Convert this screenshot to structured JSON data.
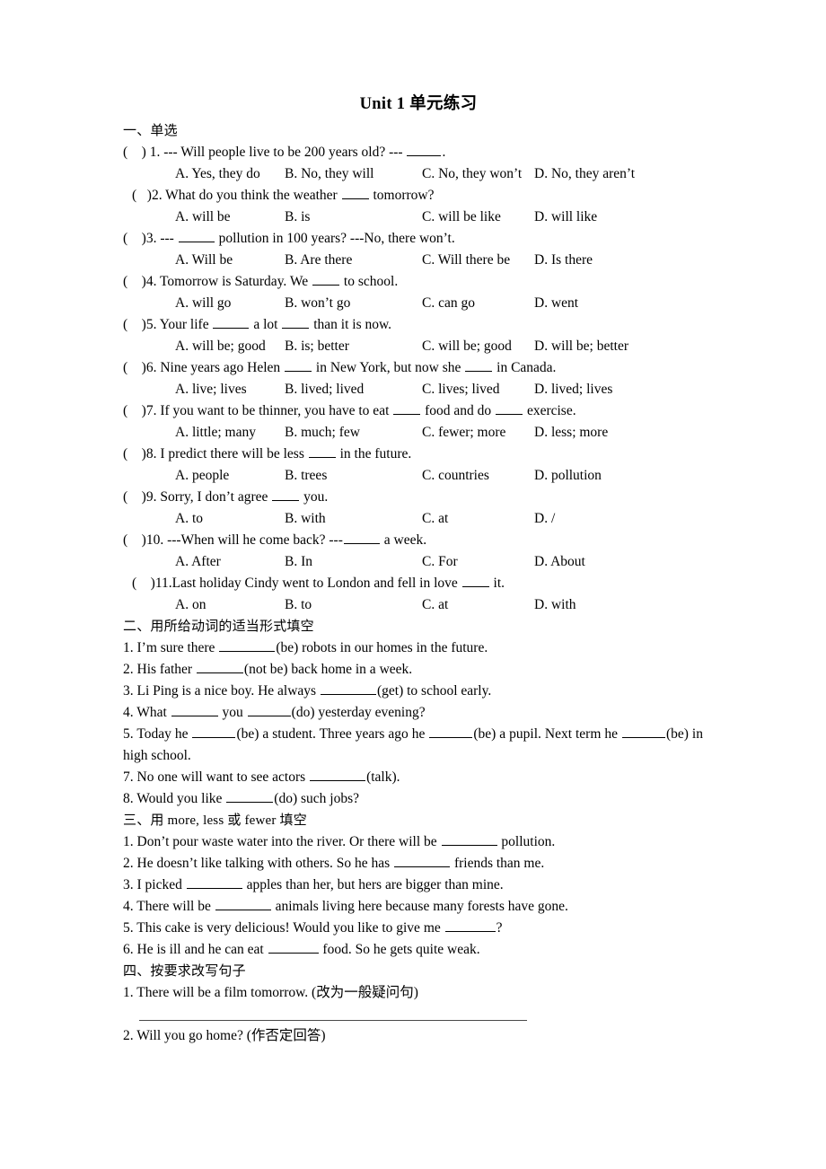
{
  "document": {
    "title": "Unit 1  单元练习"
  },
  "sections": [
    {
      "id": "section-one",
      "heading": "一、单选",
      "questions": [
        {
          "num": "1",
          "indent": false,
          "stem_pre": "(    ) 1. --- Will people live to be 200 years old? --- ",
          "blank_width": 38,
          "stem_post": ".",
          "options": [
            "A. Yes, they do",
            "B. No, they will",
            "C. No, they won’t",
            "D. No, they aren’t"
          ]
        },
        {
          "num": "2",
          "indent": true,
          "stem_pre": "(   )2. What do you think the weather ",
          "blank_width": 30,
          "stem_post": " tomorrow?",
          "options": [
            "A. will be",
            "B. is",
            "C. will be like",
            "D. will like"
          ]
        },
        {
          "num": "3",
          "indent": false,
          "stem_pre": "(    )3. --- ",
          "blank_width": 40,
          "stem_post": " pollution in 100 years? ---No, there won’t.",
          "options": [
            "A. Will be",
            "B. Are there",
            "C. Will there be",
            "D. Is there"
          ]
        },
        {
          "num": "4",
          "indent": false,
          "stem_pre": "(    )4. Tomorrow is Saturday. We ",
          "blank_width": 30,
          "stem_post": " to school.",
          "options": [
            "A. will go",
            "B. won’t go",
            "C. can go",
            "D. went"
          ]
        },
        {
          "num": "5",
          "indent": false,
          "stem_pre": "(    )5. Your life ",
          "blank_width": 40,
          "stem_mid": " a lot ",
          "blank2_width": 30,
          "stem_post": " than it is now.",
          "options": [
            "A. will be; good",
            "B. is; better",
            "C. will be; good",
            "D. will be; better"
          ]
        },
        {
          "num": "6",
          "indent": false,
          "stem_pre": "(    )6. Nine years ago Helen ",
          "blank_width": 30,
          "stem_mid": " in New York, but now she ",
          "blank2_width": 30,
          "stem_post": " in Canada.",
          "options": [
            "A. live; lives",
            "B. lived; lived",
            "C. lives; lived",
            "D. lived; lives"
          ]
        },
        {
          "num": "7",
          "indent": false,
          "stem_pre": "(    )7. If you want to be thinner, you have to eat ",
          "blank_width": 30,
          "stem_mid": " food and do ",
          "blank2_width": 30,
          "stem_post": " exercise.",
          "options": [
            "A. little; many",
            "B. much; few",
            "C. fewer; more",
            "D. less; more"
          ]
        },
        {
          "num": "8",
          "indent": false,
          "stem_pre": "(    )8. I predict there will be less ",
          "blank_width": 30,
          "stem_post": " in the future.",
          "options": [
            "A. people",
            "B. trees",
            "C. countries",
            "D. pollution"
          ]
        },
        {
          "num": "9",
          "indent": false,
          "stem_pre": "(    )9. Sorry, I don’t agree ",
          "blank_width": 30,
          "stem_post": " you.",
          "options": [
            "A. to",
            "B. with",
            "C. at",
            "D. /"
          ]
        },
        {
          "num": "10",
          "indent": false,
          "stem_pre": "(    )10. ---When will he come back? ---",
          "blank_width": 40,
          "stem_post": " a week.",
          "options": [
            "A. After",
            "B. In",
            "C. For",
            "D. About"
          ]
        },
        {
          "num": "11",
          "indent": true,
          "stem_pre": "(    )11.Last holiday Cindy went to London and fell in love ",
          "blank_width": 30,
          "stem_post": " it.",
          "options": [
            "A. on",
            "B. to",
            "C. at",
            "D. with"
          ]
        }
      ]
    },
    {
      "id": "section-two",
      "heading": "二、用所给动词的适当形式填空",
      "items": [
        {
          "pre": "1. I’m sure there ",
          "blank_width": 62,
          "post": "(be) robots in our homes in the future."
        },
        {
          "pre": "2. His father ",
          "blank_width": 52,
          "post": "(not be) back home in a week."
        },
        {
          "pre": "3. Li Ping is a nice boy. He always ",
          "blank_width": 62,
          "post": "(get) to school early."
        },
        {
          "pre": "4. What ",
          "blank_width": 52,
          "mid": " you ",
          "blank2_width": 48,
          "post": "(do) yesterday evening?"
        },
        {
          "justified": true,
          "text_pre": "5. Today he ",
          "blank_width": 48,
          "text_mid1": "(be) a student. Three years ago he ",
          "blank2_width": 48,
          "text_mid2": "(be) a pupil. Next term he ",
          "blank3_width": 48,
          "text_post": "(be) in high school."
        },
        {
          "pre": "7. No one will want to see actors ",
          "blank_width": 62,
          "post": "(talk)."
        },
        {
          "pre": "8. Would you like ",
          "blank_width": 52,
          "post": "(do) such jobs?"
        }
      ]
    },
    {
      "id": "section-three",
      "heading": "三、用 more, less 或 fewer 填空",
      "items": [
        {
          "pre": "1. Don’t pour waste water into the river. Or there will be ",
          "blank_width": 62,
          "post": " pollution."
        },
        {
          "pre": "2. He doesn’t like talking with others. So he has ",
          "blank_width": 62,
          "post": " friends than me."
        },
        {
          "pre": "3. I picked ",
          "blank_width": 62,
          "post": " apples than her, but hers are bigger than mine."
        },
        {
          "pre": "4. There will be ",
          "blank_width": 62,
          "post": " animals living here because many forests have gone."
        },
        {
          "pre": "5. This cake is very delicious! Would you like to give me ",
          "blank_width": 56,
          "post": "?"
        },
        {
          "pre": "6. He is ill and he can eat ",
          "blank_width": 56,
          "post": " food. So he gets quite weak."
        }
      ]
    },
    {
      "id": "section-four",
      "heading": "四、按要求改写句子",
      "items": [
        {
          "text": "1. There will be a film tomorrow. (改为一般疑问句)",
          "rule_after": true
        },
        {
          "text": "2. Will you go home? (作否定回答)",
          "rule_after": false
        }
      ]
    }
  ]
}
